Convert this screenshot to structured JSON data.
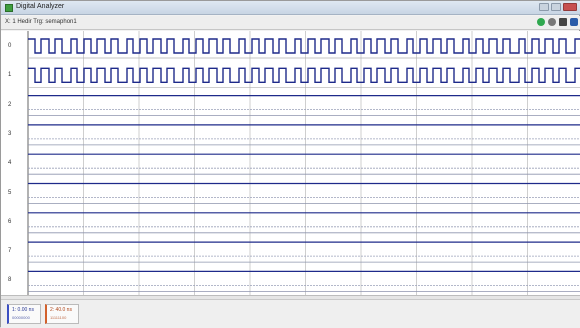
{
  "window": {
    "title": "Digital Analyzer"
  },
  "toolbar": {
    "mode_text": "X: 1 Hedir  Trg: semaphon1"
  },
  "channels": [
    {
      "label": "0",
      "kind": "clock"
    },
    {
      "label": "1",
      "kind": "clock"
    },
    {
      "label": "2",
      "kind": "flat"
    },
    {
      "label": "3",
      "kind": "flat"
    },
    {
      "label": "4",
      "kind": "flat"
    },
    {
      "label": "5",
      "kind": "flat"
    },
    {
      "label": "6",
      "kind": "flat"
    },
    {
      "label": "7",
      "kind": "flat"
    },
    {
      "label": "8",
      "kind": "flat"
    }
  ],
  "cursors": [
    {
      "label": "1:  0.00 ns",
      "sub": "00000000"
    },
    {
      "label": "2:  40.0 ns",
      "sub": "11111100"
    }
  ]
}
